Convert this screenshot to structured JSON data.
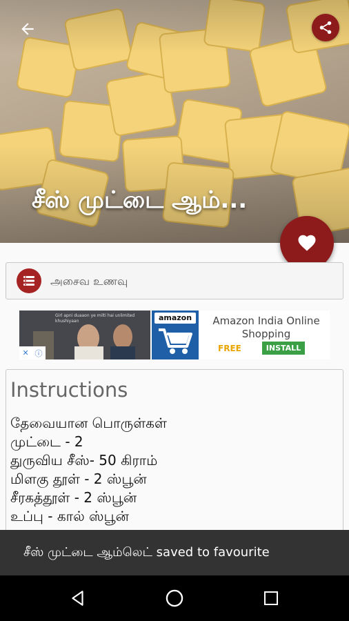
{
  "header": {
    "back_icon": "arrow-back-icon",
    "share_icon": "share-icon",
    "title": "சீஸ் முட்டை ஆம்...",
    "accent_color": "#8e1b1b"
  },
  "favourite_fab": {
    "icon": "heart-icon"
  },
  "category": {
    "icon": "list-icon",
    "label": "அசைவ உணவு"
  },
  "ad": {
    "video_caption": "Girl apni duaaon ye milti hai unlimited khushiyaan",
    "brand_text": "amazon",
    "title": "Amazon India Online Shopping",
    "free_label": "FREE",
    "install_label": "INSTALL"
  },
  "instructions": {
    "heading": "Instructions",
    "lines": [
      "தேவையான  பொருள்கள்",
      "முட்டை - 2",
      "துருவிய சீஸ்- 50 கிராம்",
      "மிளகு தூள் - 2 ஸ்பூன்",
      "சீரகத்தூள் - 2 ஸ்பூன்",
      "உப்பு - கால் ஸ்பூன்"
    ]
  },
  "snackbar": {
    "message": "சீஸ் முட்டை ஆம்லெட்  saved to favourite"
  },
  "navbar": {
    "back_icon": "nav-back-icon",
    "home_icon": "nav-home-icon",
    "recents_icon": "nav-recents-icon"
  }
}
